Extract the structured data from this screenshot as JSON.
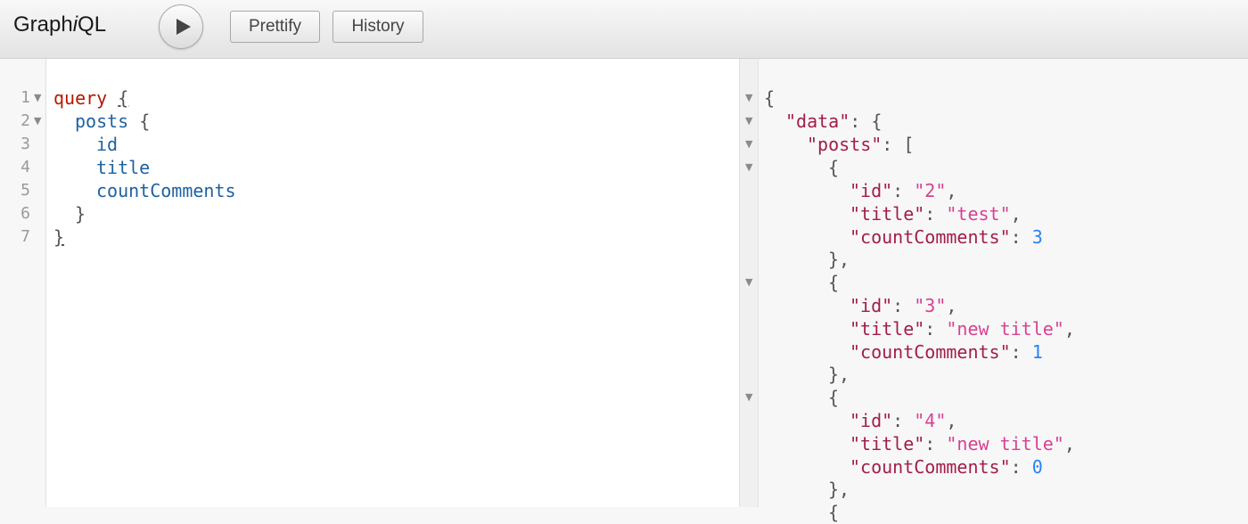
{
  "app": {
    "title_prefix": "Graph",
    "title_italic": "i",
    "title_suffix": "QL",
    "run_icon": "play-icon"
  },
  "toolbar": {
    "prettify_label": "Prettify",
    "history_label": "History"
  },
  "editor": {
    "line_numbers": [
      "1",
      "2",
      "3",
      "4",
      "5",
      "6",
      "7"
    ],
    "lines": [
      {
        "kw": "query",
        "text": " ",
        "brace": "{"
      },
      {
        "fld": "posts",
        "text": " {"
      },
      {
        "fld": "id"
      },
      {
        "fld": "title"
      },
      {
        "fld": "countComments"
      },
      {
        "text": "}"
      },
      {
        "brace": "}"
      }
    ]
  },
  "result": {
    "open": "{",
    "data_key": "\"data\"",
    "posts_key": "\"posts\"",
    "id_key": "\"id\"",
    "title_key": "\"title\"",
    "count_key": "\"countComments\"",
    "posts": [
      {
        "id": "\"2\"",
        "title": "\"test\"",
        "countComments": "3"
      },
      {
        "id": "\"3\"",
        "title": "\"new title\"",
        "countComments": "1"
      },
      {
        "id": "\"4\"",
        "title": "\"new title\"",
        "countComments": "0"
      }
    ]
  },
  "colors": {
    "keyword": "#b11a04",
    "field": "#1f61a0",
    "json_key": "#a11d4c",
    "json_string": "#d64292",
    "json_number": "#2882f9"
  }
}
